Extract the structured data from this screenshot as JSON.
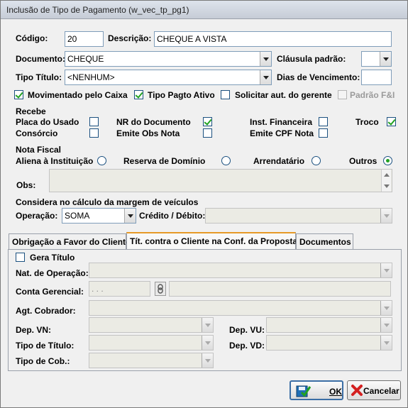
{
  "window": {
    "title": "Inclusão de Tipo de Pagamento (w_vec_tp_pg1)"
  },
  "form": {
    "codigo_label": "Código:",
    "codigo_value": "20",
    "descricao_label": "Descrição:",
    "descricao_value": "CHEQUE A VISTA",
    "documento_label": "Documento:",
    "documento_value": "CHEQUE",
    "clausula_label": "Cláusula padrão:",
    "clausula_value": "",
    "tipo_titulo_label": "Tipo Título:",
    "tipo_titulo_value": "<NENHUM>",
    "dias_venc_label": "Dias de Vencimento:",
    "dias_venc_value": ""
  },
  "flags": [
    {
      "label": "Movimentado pelo Caixa",
      "checked": true
    },
    {
      "label": "Tipo Pagto Ativo",
      "checked": true
    },
    {
      "label": "Solicitar aut. do gerente",
      "checked": false
    },
    {
      "label": "Padrão F&I",
      "checked": false,
      "disabled": true
    }
  ],
  "recebe": {
    "heading": "Recebe",
    "items": [
      {
        "label": "Placa do Usado",
        "checked": false
      },
      {
        "label": "Consórcio",
        "checked": false
      },
      {
        "label": "NR do Documento",
        "checked": true
      },
      {
        "label": "Emite Obs Nota",
        "checked": false
      },
      {
        "label": "Inst. Financeira",
        "checked": false
      },
      {
        "label": "Emite CPF Nota",
        "checked": false
      },
      {
        "label": "Troco",
        "checked": true
      }
    ]
  },
  "nota_fiscal": {
    "heading": "Nota Fiscal",
    "options": [
      {
        "label": "Aliena à Instituição",
        "selected": false
      },
      {
        "label": "Reserva de Domínio",
        "selected": false
      },
      {
        "label": "Arrendatário",
        "selected": false
      },
      {
        "label": "Outros",
        "selected": true
      }
    ],
    "obs_label": "Obs:",
    "obs_value": ""
  },
  "margem": {
    "heading": "Considera no cálculo da margem de veículos",
    "operacao_label": "Operação:",
    "operacao_value": "SOMA",
    "credito_label": "Crédito / Débito:",
    "credito_value": ""
  },
  "tabs": [
    {
      "label": "Obrigação a Favor do Cliente",
      "active": false
    },
    {
      "label": "Tít. contra o Cliente na Conf. da Proposta",
      "active": true
    },
    {
      "label": "Documentos",
      "active": false
    }
  ],
  "tab_panel": {
    "gera_titulo_label": "Gera Título",
    "gera_titulo_checked": false,
    "nat_operacao_label": "Nat. de Operação:",
    "conta_gerencial_label": "Conta Gerencial:",
    "conta_gerencial_value": ". . .",
    "agt_cobrador_label": "Agt. Cobrador:",
    "dep_vn_label": "Dep. VN:",
    "dep_vu_label": "Dep. VU:",
    "tipo_titulo_label": "Tipo de Título:",
    "dep_vd_label": "Dep. VD:",
    "tipo_cob_label": "Tipo de Cob.:"
  },
  "buttons": {
    "ok_label": "OK",
    "cancel_label": "Cancelar"
  },
  "colors": {
    "check": "#21a121",
    "active_tab": "#e69a27",
    "cancel_icon": "#d42020",
    "ok_icon": "#1f6fb6"
  }
}
